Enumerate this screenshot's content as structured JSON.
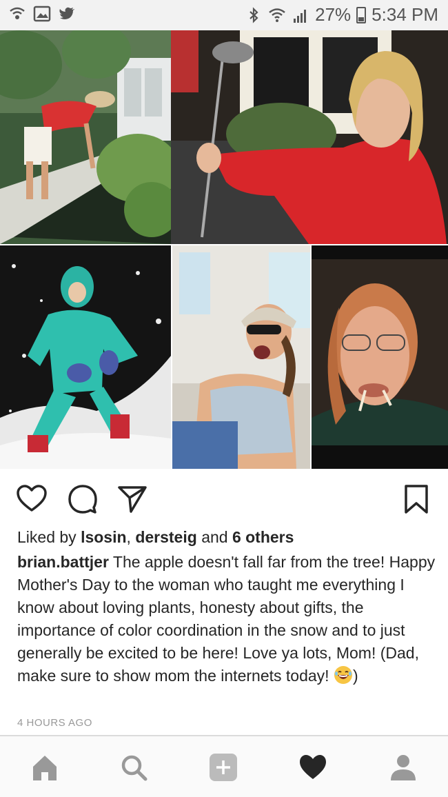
{
  "status_bar": {
    "left_icons": [
      "wifi-calling-icon",
      "gallery-icon",
      "twitter-icon"
    ],
    "right_icons": [
      "bluetooth-icon",
      "wifi-icon",
      "signal-icon",
      "battery-icon"
    ],
    "battery": "27%",
    "time": "5:34 PM"
  },
  "post": {
    "photos": [
      "photo-woman-leaning-garden",
      "photo-woman-holding-golf-club",
      "photo-woman-sitting-in-snow",
      "photo-woman-laughing-on-boat",
      "photo-woman-with-toothpicks"
    ],
    "actions": {
      "like": "heart-icon",
      "comment": "comment-icon",
      "share": "share-icon",
      "save": "bookmark-icon"
    },
    "likes": {
      "prefix": "Liked by",
      "user1": "lsosin",
      "separator": ",",
      "user2": "dersteig",
      "and": "and",
      "others": "6 others"
    },
    "caption": {
      "username": "brian.battjer",
      "text": "The apple doesn't fall far from the tree! Happy Mother's Day to the woman who taught me everything I know about loving plants, honesty about gifts, the importance of color coordination in the snow and to just generally be excited to be here! Love ya lots, Mom! (Dad, make sure to show mom the internets today!",
      "emoji": "laughing-face-emoji",
      "close": ")"
    },
    "timestamp": "4 HOURS AGO"
  },
  "bottom_nav": {
    "items": [
      "home-icon",
      "search-icon",
      "add-post-icon",
      "activity-heart-icon",
      "profile-icon"
    ]
  },
  "colors": {
    "text": "#262626",
    "muted": "#999999",
    "nav_icon": "#999999",
    "active_nav_icon": "#262626"
  }
}
